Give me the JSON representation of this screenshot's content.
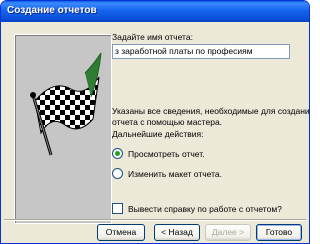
{
  "window": {
    "title": "Создание отчетов"
  },
  "form": {
    "name_label": "Задайте имя отчета:",
    "name_value": "з заработной платы по професиям",
    "info_text_line1": "Указаны все сведения, необходимые для создания",
    "info_text_line2": "отчета с помощью мастера.",
    "next_actions_label": "Дальнейшие действия:",
    "options": [
      {
        "label": "Просмотреть отчет.",
        "selected": true
      },
      {
        "label": "Изменить макет отчета.",
        "selected": false
      }
    ],
    "help_checkbox": {
      "label": "Вывести справку по работе с отчетом?",
      "checked": false
    }
  },
  "buttons": {
    "cancel": "Отмена",
    "back": "< Назад",
    "next": "Далее >",
    "finish": "Готово"
  },
  "icons": {
    "illustration": "checkered-flag-icon"
  },
  "colors": {
    "titlebar": "#0a5fe0",
    "face": "#ece9d8",
    "radio_dot": "#21a121"
  }
}
